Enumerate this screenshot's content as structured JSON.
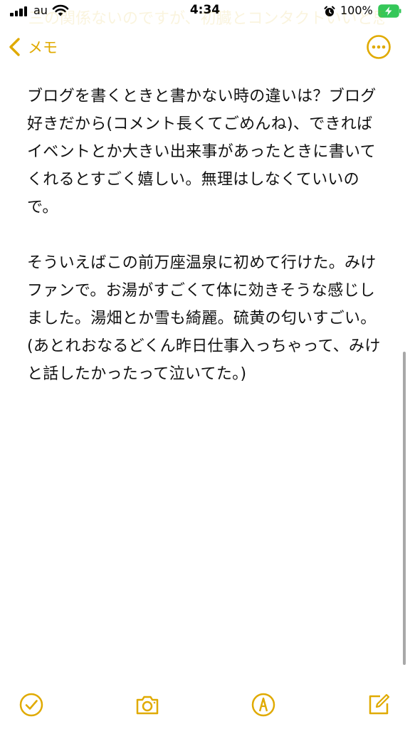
{
  "status_bar": {
    "carrier": "au",
    "time": "4:34",
    "battery_percent": "100%"
  },
  "ghost_text": "三の関係ないのですが、初臓とコンタクトいいと思う？",
  "nav": {
    "back_label": "メモ",
    "back_icon": "chevron-left-icon",
    "more_icon": "ellipsis-circle-icon"
  },
  "note": {
    "text": "ブログを書くときと書かない時の違いは？ブログ好きだから(コメント長くてごめんね)、できればイベントとか大きい出来事があったときに書いてくれるとすごく嬉しい。無理はしなくていいので。\n\nそういえばこの前万座温泉に初めて行けた。みけファンで。お湯がすごくて体に効きそうな感じしました。湯畑とか雪も綺麗。硫黄の匂いすごい。\n(あとれおなるどくん昨日仕事入っちゃって、みけと話したかったって泣いてた。)"
  },
  "toolbar": {
    "items": [
      "checklist-icon",
      "camera-icon",
      "markup-icon",
      "compose-icon"
    ]
  },
  "colors": {
    "accent": "#e0aa00",
    "text": "#111111",
    "background": "#ffffff"
  }
}
